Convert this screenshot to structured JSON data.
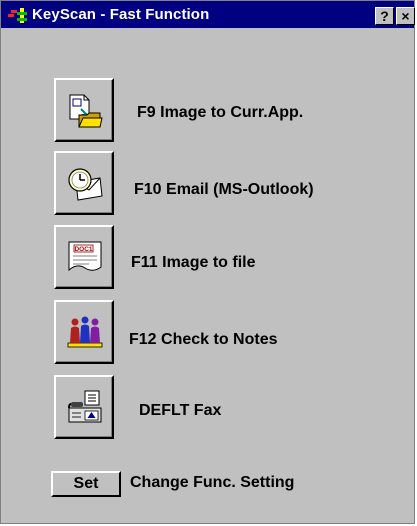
{
  "window": {
    "title": "KeyScan - Fast Function",
    "help_label": "?",
    "close_label": "×"
  },
  "functions": [
    {
      "icon": "image-to-app-icon",
      "label": "F9  Image to Curr.App."
    },
    {
      "icon": "email-icon",
      "label": "F10  Email (MS-Outlook)"
    },
    {
      "icon": "document-icon",
      "label": "F11  Image to file"
    },
    {
      "icon": "people-icon",
      "label": "F12  Check to Notes"
    },
    {
      "icon": "fax-icon",
      "label": "DEFLT   Fax"
    }
  ],
  "doc_icon_text": "DOC1",
  "settings": {
    "button_label": "Set",
    "description": "Change Func. Setting"
  },
  "colors": {
    "title_bar": "#000080",
    "face": "#c0c0c0"
  }
}
